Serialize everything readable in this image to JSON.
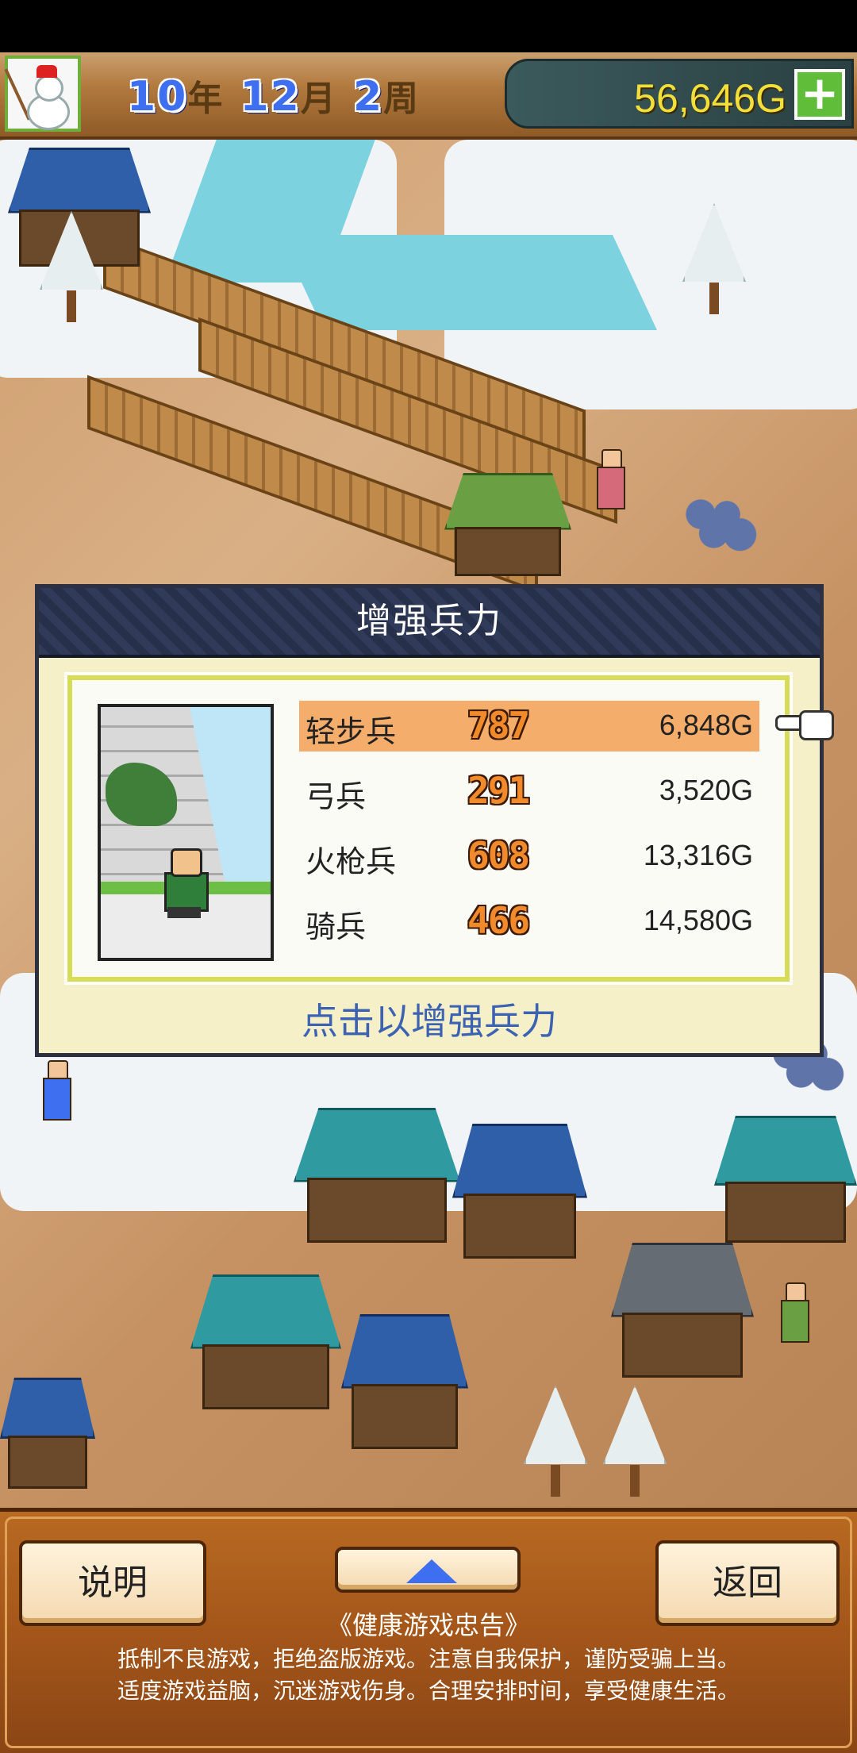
{
  "hud": {
    "year_value": "10",
    "year_unit": "年",
    "month_value": "12",
    "month_unit": "月",
    "week_value": "2",
    "week_unit": "周",
    "money": "56,646G",
    "plus_label": "+"
  },
  "dialog": {
    "title": "增强兵力",
    "units": [
      {
        "name": "轻步兵",
        "count": "787",
        "cost": "6,848G",
        "selected": true
      },
      {
        "name": "弓兵",
        "count": "291",
        "cost": "3,520G",
        "selected": false
      },
      {
        "name": "火枪兵",
        "count": "608",
        "cost": "13,316G",
        "selected": false
      },
      {
        "name": "骑兵",
        "count": "466",
        "cost": "14,580G",
        "selected": false
      }
    ],
    "hint": "点击以增强兵力"
  },
  "bottom": {
    "help_label": "说明",
    "back_label": "返回",
    "advisory_title": "《健康游戏忠告》",
    "advisory_line1": "抵制不良游戏，拒绝盗版游戏。注意自我保护，谨防受骗上当。",
    "advisory_line2": "适度游戏益脑，沉迷游戏伤身。合理安排时间，享受健康生活。"
  },
  "colors": {
    "accent_blue": "#3d6ff0",
    "money_yellow": "#f2df39",
    "selected_row": "#f4ad6b",
    "hint_text": "#3c63b3"
  }
}
